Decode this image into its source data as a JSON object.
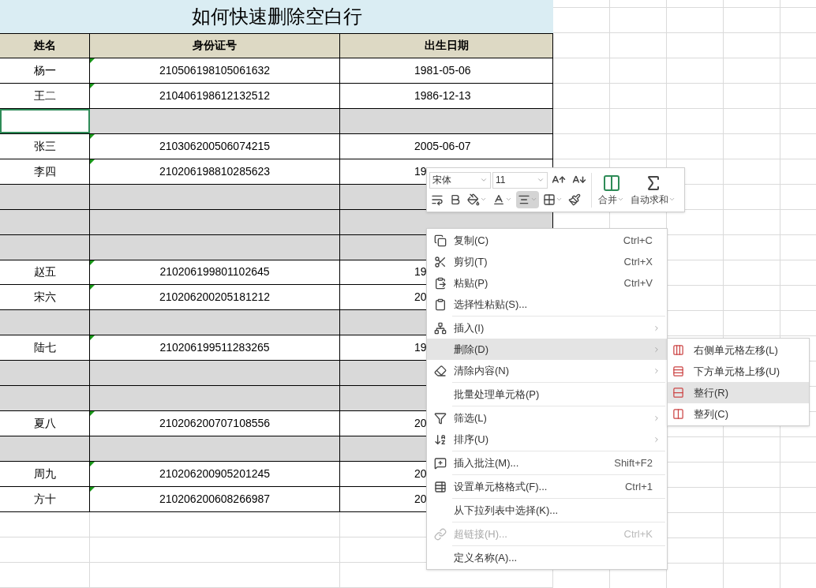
{
  "sheet": {
    "title": "如何快速删除空白行",
    "columns": [
      "姓名",
      "身份证号",
      "出生日期"
    ],
    "rows": [
      {
        "kind": "data",
        "selected": false,
        "name": "杨一",
        "id": "210506198105061632",
        "date": "1981-05-06"
      },
      {
        "kind": "data",
        "selected": false,
        "name": "王二",
        "id": "210406198612132512",
        "date": "1986-12-13"
      },
      {
        "kind": "blank",
        "selected": true
      },
      {
        "kind": "data",
        "selected": false,
        "name": "张三",
        "id": "210306200506074215",
        "date": "2005-06-07"
      },
      {
        "kind": "data",
        "selected": false,
        "name": "李四",
        "id": "210206198810285623",
        "date": "19"
      },
      {
        "kind": "blank",
        "selected": false
      },
      {
        "kind": "blank",
        "selected": false
      },
      {
        "kind": "blank",
        "selected": false
      },
      {
        "kind": "data",
        "selected": false,
        "name": "赵五",
        "id": "210206199801102645",
        "date": "19"
      },
      {
        "kind": "data",
        "selected": false,
        "name": "宋六",
        "id": "210206200205181212",
        "date": "20"
      },
      {
        "kind": "blank",
        "selected": false
      },
      {
        "kind": "data",
        "selected": false,
        "name": "陆七",
        "id": "210206199511283265",
        "date": "19"
      },
      {
        "kind": "blank",
        "selected": false
      },
      {
        "kind": "blank",
        "selected": false
      },
      {
        "kind": "data",
        "selected": false,
        "name": "夏八",
        "id": "210206200707108556",
        "date": "20"
      },
      {
        "kind": "blank",
        "selected": false
      },
      {
        "kind": "data",
        "selected": false,
        "name": "周九",
        "id": "210206200905201245",
        "date": "20"
      },
      {
        "kind": "data",
        "selected": false,
        "name": "方十",
        "id": "210206200608266987",
        "date": "20"
      }
    ]
  },
  "mini_toolbar": {
    "font": "宋体",
    "size": "11",
    "format_buttons": [
      {
        "kind": "wrap",
        "selected": false
      },
      {
        "kind": "bold",
        "selected": false
      },
      {
        "kind": "fill",
        "selected": false
      },
      {
        "kind": "font_color",
        "selected": false
      },
      {
        "kind": "align",
        "selected": true
      },
      {
        "kind": "border",
        "selected": false
      },
      {
        "kind": "painter",
        "selected": false
      }
    ],
    "merge": "合并",
    "autosum": "自动求和"
  },
  "context_menu": [
    {
      "label": "复制(C)",
      "shortcut": "Ctrl+C",
      "submenu": false,
      "highlighted": false,
      "disabled": false,
      "separator_after": false
    },
    {
      "label": "剪切(T)",
      "shortcut": "Ctrl+X",
      "submenu": false,
      "highlighted": false,
      "disabled": false,
      "separator_after": false
    },
    {
      "label": "粘贴(P)",
      "shortcut": "Ctrl+V",
      "submenu": false,
      "highlighted": false,
      "disabled": false,
      "separator_after": false
    },
    {
      "label": "选择性粘贴(S)...",
      "submenu": false,
      "highlighted": false,
      "disabled": false,
      "separator_after": true
    },
    {
      "label": "插入(I)",
      "submenu": true,
      "highlighted": false,
      "disabled": false,
      "separator_after": false
    },
    {
      "label": "删除(D)",
      "submenu": true,
      "highlighted": true,
      "disabled": false,
      "separator_after": false
    },
    {
      "label": "清除内容(N)",
      "submenu": true,
      "highlighted": false,
      "disabled": false,
      "separator_after": true
    },
    {
      "label": "批量处理单元格(P)",
      "submenu": false,
      "highlighted": false,
      "disabled": false,
      "separator_after": true
    },
    {
      "label": "筛选(L)",
      "submenu": true,
      "highlighted": false,
      "disabled": false,
      "separator_after": false
    },
    {
      "label": "排序(U)",
      "submenu": true,
      "highlighted": false,
      "disabled": false,
      "separator_after": true
    },
    {
      "label": "插入批注(M)...",
      "shortcut": "Shift+F2",
      "submenu": false,
      "highlighted": false,
      "disabled": false,
      "separator_after": true
    },
    {
      "label": "设置单元格格式(F)...",
      "shortcut": "Ctrl+1",
      "submenu": false,
      "highlighted": false,
      "disabled": false,
      "separator_after": true
    },
    {
      "label": "从下拉列表中选择(K)...",
      "submenu": false,
      "highlighted": false,
      "disabled": false,
      "separator_after": true
    },
    {
      "label": "超链接(H)...",
      "shortcut": "Ctrl+K",
      "submenu": false,
      "highlighted": false,
      "disabled": true,
      "separator_after": true
    },
    {
      "label": "定义名称(A)...",
      "submenu": false,
      "highlighted": false,
      "disabled": false,
      "separator_after": false
    }
  ],
  "delete_submenu": [
    {
      "label": "右侧单元格左移(L)",
      "highlighted": false
    },
    {
      "label": "下方单元格上移(U)",
      "highlighted": false
    },
    {
      "label": "整行(R)",
      "highlighted": true
    },
    {
      "label": "整列(C)",
      "highlighted": false
    }
  ]
}
